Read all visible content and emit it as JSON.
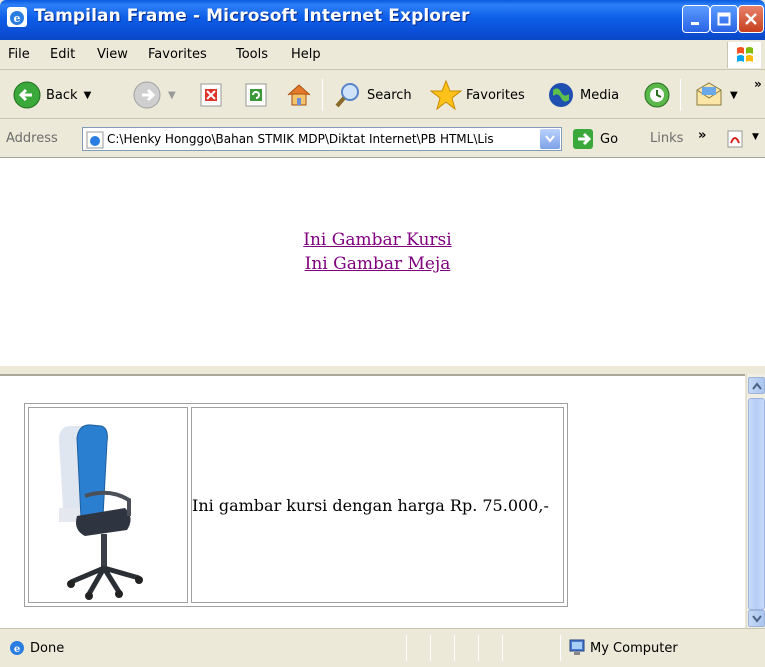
{
  "window": {
    "title": "Tampilan Frame - Microsoft Internet Explorer"
  },
  "menu": {
    "items": [
      "File",
      "Edit",
      "View",
      "Favorites",
      "Tools",
      "Help"
    ]
  },
  "toolbar": {
    "back_label": "Back",
    "search_label": "Search",
    "favorites_label": "Favorites",
    "media_label": "Media"
  },
  "address": {
    "label": "Address",
    "value": "C:\\Henky Honggo\\Bahan STMIK MDP\\Diktat Internet\\PB HTML\\Lis",
    "go_label": "Go",
    "links_label": "Links"
  },
  "top_frame": {
    "links": [
      "Ini Gambar Kursi",
      "Ini Gambar Meja"
    ]
  },
  "bottom_frame": {
    "product_text": "Ini gambar kursi dengan harga Rp. 75.000,-"
  },
  "status": {
    "text": "Done",
    "zone": "My Computer"
  },
  "colors": {
    "titlebar": "#0B4FD6",
    "visited_link": "#800080",
    "chrome": "#ECE9D8"
  }
}
